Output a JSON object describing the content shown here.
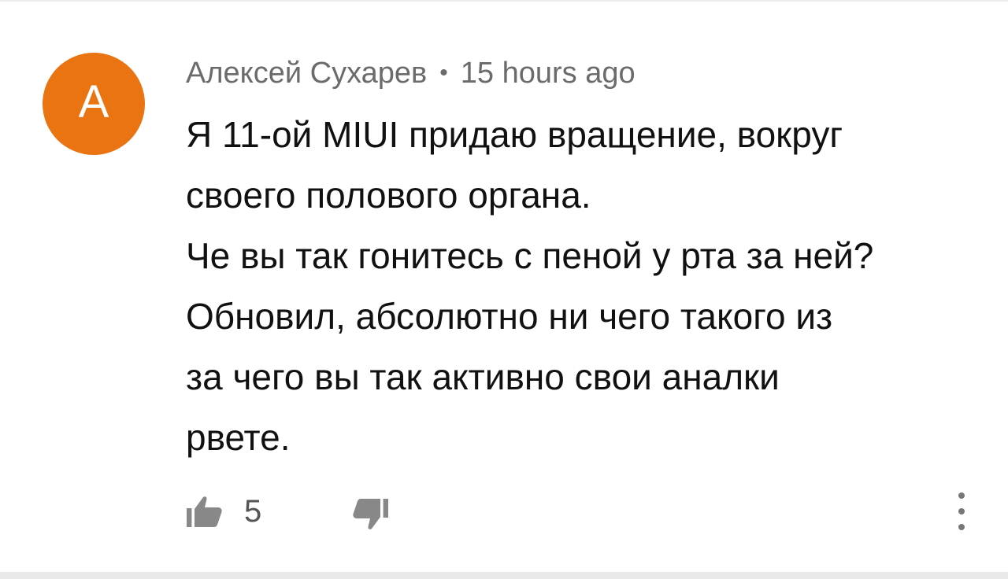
{
  "comment": {
    "avatar_letter": "A",
    "avatar_color": "#ea7411",
    "author": "Алексей Сухарев",
    "separator": "•",
    "timestamp": "15 hours ago",
    "body_lines": [
      "Я 11-ой MIUI придаю вращение, вокруг",
      "своего полового органа.",
      "Че вы так гонитесь с пеной у рта за ней?",
      "Обновил, абсолютно ни чего такого из",
      "за чего вы так активно свои аналки",
      "рвете."
    ],
    "like_count": "5",
    "icons": {
      "like": "thumb-up-icon",
      "dislike": "thumb-down-icon",
      "more": "more-vertical-icon"
    }
  }
}
